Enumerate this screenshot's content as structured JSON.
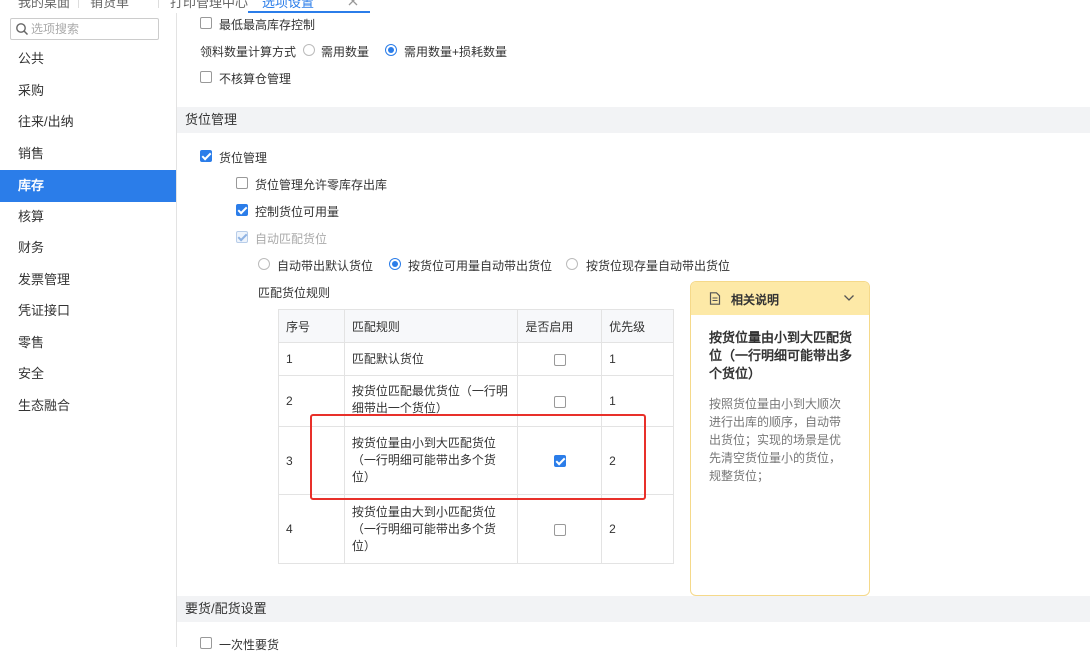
{
  "tabs": [
    {
      "label": "我的桌面"
    },
    {
      "label": "销货单"
    },
    {
      "label": "打印管理中心"
    },
    {
      "label": "选项设置",
      "active": true
    }
  ],
  "sidebar": {
    "search_placeholder": "选项搜索",
    "items": [
      {
        "label": "公共"
      },
      {
        "label": "采购"
      },
      {
        "label": "往来/出纳"
      },
      {
        "label": "销售"
      },
      {
        "label": "库存",
        "active": true
      },
      {
        "label": "核算"
      },
      {
        "label": "财务"
      },
      {
        "label": "发票管理"
      },
      {
        "label": "凭证接口"
      },
      {
        "label": "零售"
      },
      {
        "label": "安全"
      },
      {
        "label": "生态融合"
      }
    ]
  },
  "inventory": {
    "min_max_stock": {
      "label": "最低最高库存控制",
      "checked": false
    },
    "calc_method": {
      "label": "领料数量计算方式",
      "options": [
        {
          "label": "需用数量",
          "selected": false
        },
        {
          "label": "需用数量+损耗数量",
          "selected": true
        }
      ]
    },
    "no_warehouse_calc": {
      "label": "不核算仓管理",
      "checked": false
    }
  },
  "location": {
    "section_title": "货位管理",
    "enable": {
      "label": "货位管理",
      "checked": true
    },
    "allow_zero": {
      "label": "货位管理允许零库存出库",
      "checked": false
    },
    "control_available": {
      "label": "控制货位可用量",
      "checked": true
    },
    "auto_match": {
      "label": "自动匹配货位",
      "checked": true,
      "disabled": true
    },
    "auto_options": [
      {
        "label": "自动带出默认货位",
        "selected": false
      },
      {
        "label": "按货位可用量自动带出货位",
        "selected": true
      },
      {
        "label": "按货位现存量自动带出货位",
        "selected": false
      }
    ],
    "rules_label": "匹配货位规则",
    "table": {
      "headers": [
        "序号",
        "匹配规则",
        "是否启用",
        "优先级"
      ],
      "rows": [
        {
          "no": "1",
          "rule": "匹配默认货位",
          "enabled": false,
          "priority": "1"
        },
        {
          "no": "2",
          "rule": "按货位匹配最优货位（一行明细带出一个货位）",
          "enabled": false,
          "priority": "1"
        },
        {
          "no": "3",
          "rule": "按货位量由小到大匹配货位（一行明细可能带出多个货位）",
          "enabled": true,
          "priority": "2"
        },
        {
          "no": "4",
          "rule": "按货位量由大到小匹配货位（一行明细可能带出多个货位）",
          "enabled": false,
          "priority": "2"
        }
      ]
    }
  },
  "help": {
    "title": "相关说明",
    "heading": "按货位量由小到大匹配货位（一行明细可能带出多个货位）",
    "body": "按照货位量由小到大顺次进行出库的顺序，自动带出货位；实现的场景是优先清空货位量小的货位，规整货位；"
  },
  "delivery": {
    "section_title": "要货/配货设置",
    "one_time": {
      "label": "一次性要货",
      "checked": false
    }
  },
  "colors": {
    "accent": "#2b7de9",
    "highlight": "#e8302a",
    "card_head": "#fde9a7"
  }
}
